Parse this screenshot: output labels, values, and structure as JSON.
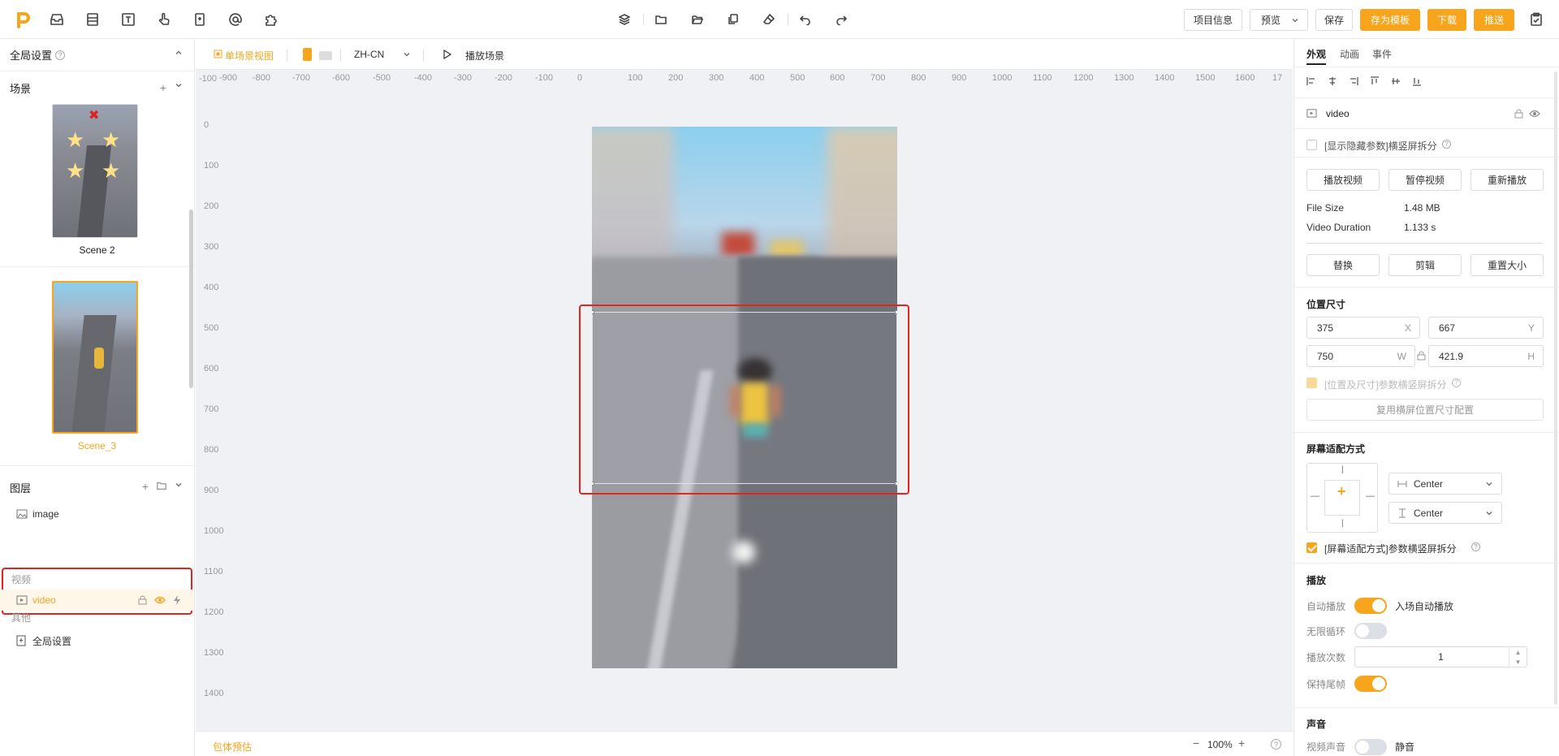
{
  "toolbar": {
    "left_icons": [
      "inbox-icon",
      "layout-icon",
      "text-icon",
      "gesture-icon",
      "page-icon",
      "at-icon",
      "plugin-icon"
    ],
    "center_icons": [
      "layers-icon",
      "folder-icon",
      "folder-open-icon",
      "copy-icon",
      "eraser-icon",
      "undo-icon",
      "redo-icon"
    ],
    "project_info": "项目信息",
    "preview": "预览",
    "save": "保存",
    "save_template": "存为模板",
    "download": "下载",
    "push": "推送"
  },
  "left": {
    "global_settings": "全局设置",
    "scenes_title": "场景",
    "scenes": [
      {
        "label": "Scene 2"
      },
      {
        "label": "Scene_3",
        "active": true
      }
    ],
    "layers_title": "图层",
    "layers": {
      "image": "image",
      "group_video": "视频",
      "video": "video",
      "group_other": "其他",
      "global": "全局设置"
    }
  },
  "canvas": {
    "single_scene_view": "单场景视图",
    "language": "ZH-CN",
    "play_scene": "播放场景",
    "ruler_h": [
      "-900",
      "-800",
      "-700",
      "-600",
      "-500",
      "-400",
      "-300",
      "-200",
      "-100",
      "0",
      "100",
      "200",
      "300",
      "400",
      "500",
      "600",
      "700",
      "800",
      "900",
      "1000",
      "1100",
      "1200",
      "1300",
      "1400",
      "1500",
      "1600",
      "17"
    ],
    "ruler_v": [
      "-100",
      "0",
      "100",
      "200",
      "300",
      "400",
      "500",
      "600",
      "700",
      "800",
      "900",
      "1000",
      "1100",
      "1200",
      "1300",
      "1400"
    ],
    "package_estimate": "包体预估",
    "zoom": "100%"
  },
  "right": {
    "tabs": [
      "外观",
      "动画",
      "事件"
    ],
    "element_name": "video",
    "show_hidden": "[显示隐藏参数]横竖屏拆分",
    "play_video": "播放视频",
    "pause_video": "暂停视频",
    "replay": "重新播放",
    "file_size_label": "File Size",
    "file_size_value": "1.48 MB",
    "duration_label": "Video Duration",
    "duration_value": "1.133 s",
    "replace": "替换",
    "crop": "剪辑",
    "reset_size": "重置大小",
    "position_title": "位置尺寸",
    "x": "375",
    "x_label": "X",
    "y": "667",
    "y_label": "Y",
    "w": "750",
    "w_label": "W",
    "h": "421.9",
    "h_label": "H",
    "pos_split": "[位置及尺寸]参数横竖屏拆分",
    "reuse_landscape": "复用横屏位置尺寸配置",
    "fit_title": "屏幕适配方式",
    "fit_h": "Center",
    "fit_v": "Center",
    "fit_split": "[屏幕适配方式]参数横竖屏拆分",
    "playback_title": "播放",
    "autoplay_label": "自动播放",
    "autoplay_on": true,
    "autoplay_desc": "入场自动播放",
    "loop_label": "无限循环",
    "loop_on": false,
    "count_label": "播放次数",
    "count_value": "1",
    "keep_last_label": "保持尾帧",
    "keep_last_on": true,
    "sound_title": "声音",
    "video_sound_label": "视频声音",
    "video_sound_on": false,
    "mute_label": "静音"
  },
  "colors": {
    "accent": "#f7a51c",
    "highlight_border": "#e8231d"
  }
}
